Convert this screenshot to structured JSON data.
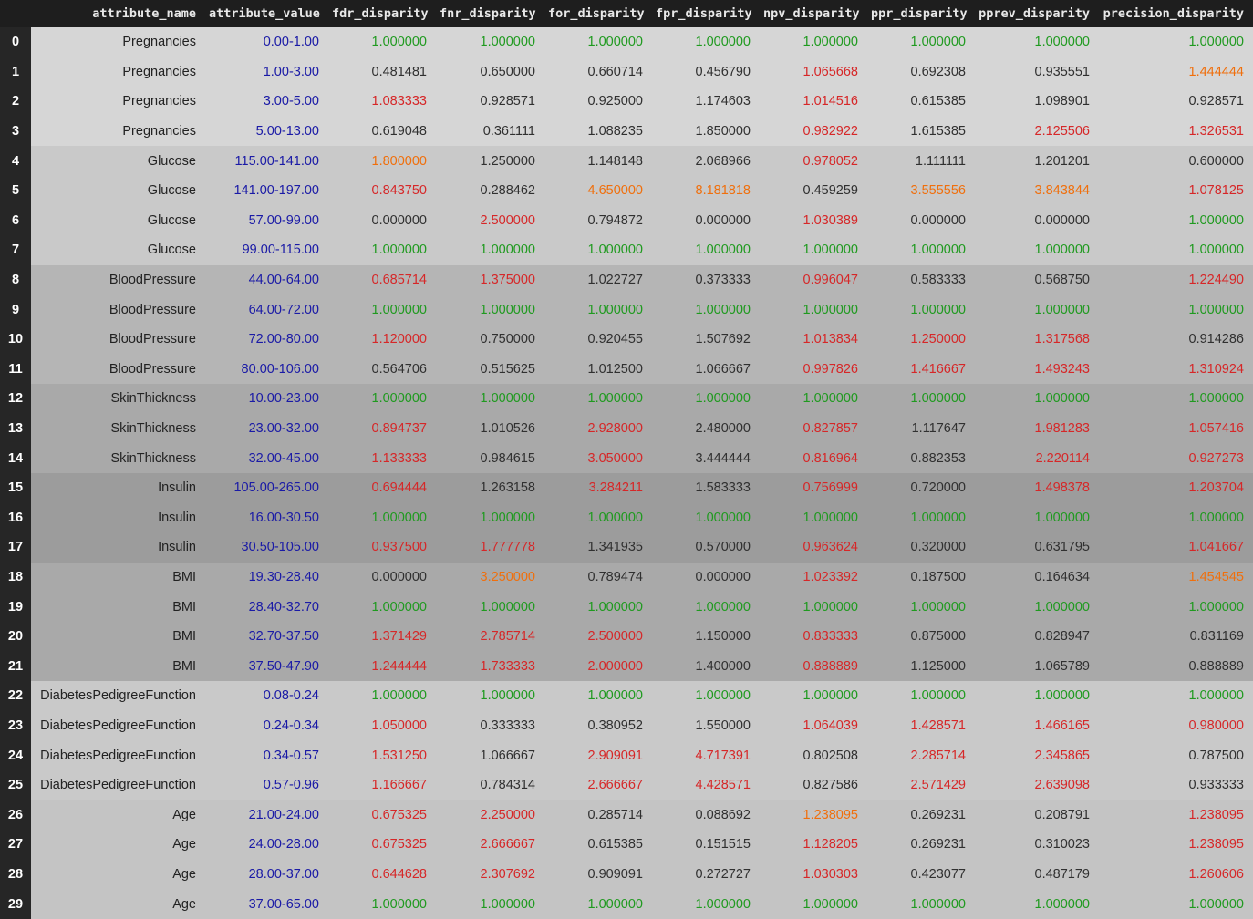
{
  "columns": [
    "attribute_name",
    "attribute_value",
    "fdr_disparity",
    "fnr_disparity",
    "for_disparity",
    "fpr_disparity",
    "npv_disparity",
    "ppr_disparity",
    "pprev_disparity",
    "precision_disparity"
  ],
  "group_backgrounds": {
    "Pregnancies": "#d6d6d6",
    "Glucose": "#c9c9c9",
    "BloodPressure": "#b5b5b5",
    "SkinThickness": "#a9a9a9",
    "Insulin": "#9c9c9c",
    "BMI": "#a9a9a9",
    "DiabetesPedigreeFunction": "#c9c9c9",
    "Age": "#c4c4c4"
  },
  "rows": [
    {
      "index": "0",
      "name": "Pregnancies",
      "value": "0.00-1.00",
      "cells": [
        [
          "1.000000",
          "green"
        ],
        [
          "1.000000",
          "green"
        ],
        [
          "1.000000",
          "green"
        ],
        [
          "1.000000",
          "green"
        ],
        [
          "1.000000",
          "green"
        ],
        [
          "1.000000",
          "green"
        ],
        [
          "1.000000",
          "green"
        ],
        [
          "1.000000",
          "green"
        ]
      ]
    },
    {
      "index": "1",
      "name": "Pregnancies",
      "value": "1.00-3.00",
      "cells": [
        [
          "0.481481",
          "black"
        ],
        [
          "0.650000",
          "black"
        ],
        [
          "0.660714",
          "black"
        ],
        [
          "0.456790",
          "black"
        ],
        [
          "1.065668",
          "red"
        ],
        [
          "0.692308",
          "black"
        ],
        [
          "0.935551",
          "black"
        ],
        [
          "1.444444",
          "orange"
        ]
      ]
    },
    {
      "index": "2",
      "name": "Pregnancies",
      "value": "3.00-5.00",
      "cells": [
        [
          "1.083333",
          "red"
        ],
        [
          "0.928571",
          "black"
        ],
        [
          "0.925000",
          "black"
        ],
        [
          "1.174603",
          "black"
        ],
        [
          "1.014516",
          "red"
        ],
        [
          "0.615385",
          "black"
        ],
        [
          "1.098901",
          "black"
        ],
        [
          "0.928571",
          "black"
        ]
      ]
    },
    {
      "index": "3",
      "name": "Pregnancies",
      "value": "5.00-13.00",
      "cells": [
        [
          "0.619048",
          "black"
        ],
        [
          "0.361111",
          "black"
        ],
        [
          "1.088235",
          "black"
        ],
        [
          "1.850000",
          "black"
        ],
        [
          "0.982922",
          "red"
        ],
        [
          "1.615385",
          "black"
        ],
        [
          "2.125506",
          "red"
        ],
        [
          "1.326531",
          "red"
        ]
      ]
    },
    {
      "index": "4",
      "name": "Glucose",
      "value": "115.00-141.00",
      "cells": [
        [
          "1.800000",
          "orange"
        ],
        [
          "1.250000",
          "black"
        ],
        [
          "1.148148",
          "black"
        ],
        [
          "2.068966",
          "black"
        ],
        [
          "0.978052",
          "red"
        ],
        [
          "1.111111",
          "black"
        ],
        [
          "1.201201",
          "black"
        ],
        [
          "0.600000",
          "black"
        ]
      ]
    },
    {
      "index": "5",
      "name": "Glucose",
      "value": "141.00-197.00",
      "cells": [
        [
          "0.843750",
          "red"
        ],
        [
          "0.288462",
          "black"
        ],
        [
          "4.650000",
          "orange"
        ],
        [
          "8.181818",
          "orange"
        ],
        [
          "0.459259",
          "black"
        ],
        [
          "3.555556",
          "orange"
        ],
        [
          "3.843844",
          "orange"
        ],
        [
          "1.078125",
          "red"
        ]
      ]
    },
    {
      "index": "6",
      "name": "Glucose",
      "value": "57.00-99.00",
      "cells": [
        [
          "0.000000",
          "black"
        ],
        [
          "2.500000",
          "red"
        ],
        [
          "0.794872",
          "black"
        ],
        [
          "0.000000",
          "black"
        ],
        [
          "1.030389",
          "red"
        ],
        [
          "0.000000",
          "black"
        ],
        [
          "0.000000",
          "black"
        ],
        [
          "1.000000",
          "green"
        ]
      ]
    },
    {
      "index": "7",
      "name": "Glucose",
      "value": "99.00-115.00",
      "cells": [
        [
          "1.000000",
          "green"
        ],
        [
          "1.000000",
          "green"
        ],
        [
          "1.000000",
          "green"
        ],
        [
          "1.000000",
          "green"
        ],
        [
          "1.000000",
          "green"
        ],
        [
          "1.000000",
          "green"
        ],
        [
          "1.000000",
          "green"
        ],
        [
          "1.000000",
          "green"
        ]
      ]
    },
    {
      "index": "8",
      "name": "BloodPressure",
      "value": "44.00-64.00",
      "cells": [
        [
          "0.685714",
          "red"
        ],
        [
          "1.375000",
          "red"
        ],
        [
          "1.022727",
          "black"
        ],
        [
          "0.373333",
          "black"
        ],
        [
          "0.996047",
          "red"
        ],
        [
          "0.583333",
          "black"
        ],
        [
          "0.568750",
          "black"
        ],
        [
          "1.224490",
          "red"
        ]
      ]
    },
    {
      "index": "9",
      "name": "BloodPressure",
      "value": "64.00-72.00",
      "cells": [
        [
          "1.000000",
          "green"
        ],
        [
          "1.000000",
          "green"
        ],
        [
          "1.000000",
          "green"
        ],
        [
          "1.000000",
          "green"
        ],
        [
          "1.000000",
          "green"
        ],
        [
          "1.000000",
          "green"
        ],
        [
          "1.000000",
          "green"
        ],
        [
          "1.000000",
          "green"
        ]
      ]
    },
    {
      "index": "10",
      "name": "BloodPressure",
      "value": "72.00-80.00",
      "cells": [
        [
          "1.120000",
          "red"
        ],
        [
          "0.750000",
          "black"
        ],
        [
          "0.920455",
          "black"
        ],
        [
          "1.507692",
          "black"
        ],
        [
          "1.013834",
          "red"
        ],
        [
          "1.250000",
          "red"
        ],
        [
          "1.317568",
          "red"
        ],
        [
          "0.914286",
          "black"
        ]
      ]
    },
    {
      "index": "11",
      "name": "BloodPressure",
      "value": "80.00-106.00",
      "cells": [
        [
          "0.564706",
          "black"
        ],
        [
          "0.515625",
          "black"
        ],
        [
          "1.012500",
          "black"
        ],
        [
          "1.066667",
          "black"
        ],
        [
          "0.997826",
          "red"
        ],
        [
          "1.416667",
          "red"
        ],
        [
          "1.493243",
          "red"
        ],
        [
          "1.310924",
          "red"
        ]
      ]
    },
    {
      "index": "12",
      "name": "SkinThickness",
      "value": "10.00-23.00",
      "cells": [
        [
          "1.000000",
          "green"
        ],
        [
          "1.000000",
          "green"
        ],
        [
          "1.000000",
          "green"
        ],
        [
          "1.000000",
          "green"
        ],
        [
          "1.000000",
          "green"
        ],
        [
          "1.000000",
          "green"
        ],
        [
          "1.000000",
          "green"
        ],
        [
          "1.000000",
          "green"
        ]
      ]
    },
    {
      "index": "13",
      "name": "SkinThickness",
      "value": "23.00-32.00",
      "cells": [
        [
          "0.894737",
          "red"
        ],
        [
          "1.010526",
          "black"
        ],
        [
          "2.928000",
          "red"
        ],
        [
          "2.480000",
          "black"
        ],
        [
          "0.827857",
          "red"
        ],
        [
          "1.117647",
          "black"
        ],
        [
          "1.981283",
          "red"
        ],
        [
          "1.057416",
          "red"
        ]
      ]
    },
    {
      "index": "14",
      "name": "SkinThickness",
      "value": "32.00-45.00",
      "cells": [
        [
          "1.133333",
          "red"
        ],
        [
          "0.984615",
          "black"
        ],
        [
          "3.050000",
          "red"
        ],
        [
          "3.444444",
          "black"
        ],
        [
          "0.816964",
          "red"
        ],
        [
          "0.882353",
          "black"
        ],
        [
          "2.220114",
          "red"
        ],
        [
          "0.927273",
          "red"
        ]
      ]
    },
    {
      "index": "15",
      "name": "Insulin",
      "value": "105.00-265.00",
      "cells": [
        [
          "0.694444",
          "red"
        ],
        [
          "1.263158",
          "black"
        ],
        [
          "3.284211",
          "red"
        ],
        [
          "1.583333",
          "black"
        ],
        [
          "0.756999",
          "red"
        ],
        [
          "0.720000",
          "black"
        ],
        [
          "1.498378",
          "red"
        ],
        [
          "1.203704",
          "red"
        ]
      ]
    },
    {
      "index": "16",
      "name": "Insulin",
      "value": "16.00-30.50",
      "cells": [
        [
          "1.000000",
          "green"
        ],
        [
          "1.000000",
          "green"
        ],
        [
          "1.000000",
          "green"
        ],
        [
          "1.000000",
          "green"
        ],
        [
          "1.000000",
          "green"
        ],
        [
          "1.000000",
          "green"
        ],
        [
          "1.000000",
          "green"
        ],
        [
          "1.000000",
          "green"
        ]
      ]
    },
    {
      "index": "17",
      "name": "Insulin",
      "value": "30.50-105.00",
      "cells": [
        [
          "0.937500",
          "red"
        ],
        [
          "1.777778",
          "red"
        ],
        [
          "1.341935",
          "black"
        ],
        [
          "0.570000",
          "black"
        ],
        [
          "0.963624",
          "red"
        ],
        [
          "0.320000",
          "black"
        ],
        [
          "0.631795",
          "black"
        ],
        [
          "1.041667",
          "red"
        ]
      ]
    },
    {
      "index": "18",
      "name": "BMI",
      "value": "19.30-28.40",
      "cells": [
        [
          "0.000000",
          "black"
        ],
        [
          "3.250000",
          "orange"
        ],
        [
          "0.789474",
          "black"
        ],
        [
          "0.000000",
          "black"
        ],
        [
          "1.023392",
          "red"
        ],
        [
          "0.187500",
          "black"
        ],
        [
          "0.164634",
          "black"
        ],
        [
          "1.454545",
          "orange"
        ]
      ]
    },
    {
      "index": "19",
      "name": "BMI",
      "value": "28.40-32.70",
      "cells": [
        [
          "1.000000",
          "green"
        ],
        [
          "1.000000",
          "green"
        ],
        [
          "1.000000",
          "green"
        ],
        [
          "1.000000",
          "green"
        ],
        [
          "1.000000",
          "green"
        ],
        [
          "1.000000",
          "green"
        ],
        [
          "1.000000",
          "green"
        ],
        [
          "1.000000",
          "green"
        ]
      ]
    },
    {
      "index": "20",
      "name": "BMI",
      "value": "32.70-37.50",
      "cells": [
        [
          "1.371429",
          "red"
        ],
        [
          "2.785714",
          "red"
        ],
        [
          "2.500000",
          "red"
        ],
        [
          "1.150000",
          "black"
        ],
        [
          "0.833333",
          "red"
        ],
        [
          "0.875000",
          "black"
        ],
        [
          "0.828947",
          "black"
        ],
        [
          "0.831169",
          "black"
        ]
      ]
    },
    {
      "index": "21",
      "name": "BMI",
      "value": "37.50-47.90",
      "cells": [
        [
          "1.244444",
          "red"
        ],
        [
          "1.733333",
          "red"
        ],
        [
          "2.000000",
          "red"
        ],
        [
          "1.400000",
          "black"
        ],
        [
          "0.888889",
          "red"
        ],
        [
          "1.125000",
          "black"
        ],
        [
          "1.065789",
          "black"
        ],
        [
          "0.888889",
          "black"
        ]
      ]
    },
    {
      "index": "22",
      "name": "DiabetesPedigreeFunction",
      "value": "0.08-0.24",
      "cells": [
        [
          "1.000000",
          "green"
        ],
        [
          "1.000000",
          "green"
        ],
        [
          "1.000000",
          "green"
        ],
        [
          "1.000000",
          "green"
        ],
        [
          "1.000000",
          "green"
        ],
        [
          "1.000000",
          "green"
        ],
        [
          "1.000000",
          "green"
        ],
        [
          "1.000000",
          "green"
        ]
      ]
    },
    {
      "index": "23",
      "name": "DiabetesPedigreeFunction",
      "value": "0.24-0.34",
      "cells": [
        [
          "1.050000",
          "red"
        ],
        [
          "0.333333",
          "black"
        ],
        [
          "0.380952",
          "black"
        ],
        [
          "1.550000",
          "black"
        ],
        [
          "1.064039",
          "red"
        ],
        [
          "1.428571",
          "red"
        ],
        [
          "1.466165",
          "red"
        ],
        [
          "0.980000",
          "red"
        ]
      ]
    },
    {
      "index": "24",
      "name": "DiabetesPedigreeFunction",
      "value": "0.34-0.57",
      "cells": [
        [
          "1.531250",
          "red"
        ],
        [
          "1.066667",
          "black"
        ],
        [
          "2.909091",
          "red"
        ],
        [
          "4.717391",
          "red"
        ],
        [
          "0.802508",
          "black"
        ],
        [
          "2.285714",
          "red"
        ],
        [
          "2.345865",
          "red"
        ],
        [
          "0.787500",
          "black"
        ]
      ]
    },
    {
      "index": "25",
      "name": "DiabetesPedigreeFunction",
      "value": "0.57-0.96",
      "cells": [
        [
          "1.166667",
          "red"
        ],
        [
          "0.784314",
          "black"
        ],
        [
          "2.666667",
          "red"
        ],
        [
          "4.428571",
          "red"
        ],
        [
          "0.827586",
          "black"
        ],
        [
          "2.571429",
          "red"
        ],
        [
          "2.639098",
          "red"
        ],
        [
          "0.933333",
          "black"
        ]
      ]
    },
    {
      "index": "26",
      "name": "Age",
      "value": "21.00-24.00",
      "cells": [
        [
          "0.675325",
          "red"
        ],
        [
          "2.250000",
          "red"
        ],
        [
          "0.285714",
          "black"
        ],
        [
          "0.088692",
          "black"
        ],
        [
          "1.238095",
          "orange"
        ],
        [
          "0.269231",
          "black"
        ],
        [
          "0.208791",
          "black"
        ],
        [
          "1.238095",
          "red"
        ]
      ]
    },
    {
      "index": "27",
      "name": "Age",
      "value": "24.00-28.00",
      "cells": [
        [
          "0.675325",
          "red"
        ],
        [
          "2.666667",
          "red"
        ],
        [
          "0.615385",
          "black"
        ],
        [
          "0.151515",
          "black"
        ],
        [
          "1.128205",
          "red"
        ],
        [
          "0.269231",
          "black"
        ],
        [
          "0.310023",
          "black"
        ],
        [
          "1.238095",
          "red"
        ]
      ]
    },
    {
      "index": "28",
      "name": "Age",
      "value": "28.00-37.00",
      "cells": [
        [
          "0.644628",
          "red"
        ],
        [
          "2.307692",
          "red"
        ],
        [
          "0.909091",
          "black"
        ],
        [
          "0.272727",
          "black"
        ],
        [
          "1.030303",
          "red"
        ],
        [
          "0.423077",
          "black"
        ],
        [
          "0.487179",
          "black"
        ],
        [
          "1.260606",
          "red"
        ]
      ]
    },
    {
      "index": "29",
      "name": "Age",
      "value": "37.00-65.00",
      "cells": [
        [
          "1.000000",
          "green"
        ],
        [
          "1.000000",
          "green"
        ],
        [
          "1.000000",
          "green"
        ],
        [
          "1.000000",
          "green"
        ],
        [
          "1.000000",
          "green"
        ],
        [
          "1.000000",
          "green"
        ],
        [
          "1.000000",
          "green"
        ],
        [
          "1.000000",
          "green"
        ]
      ]
    }
  ]
}
